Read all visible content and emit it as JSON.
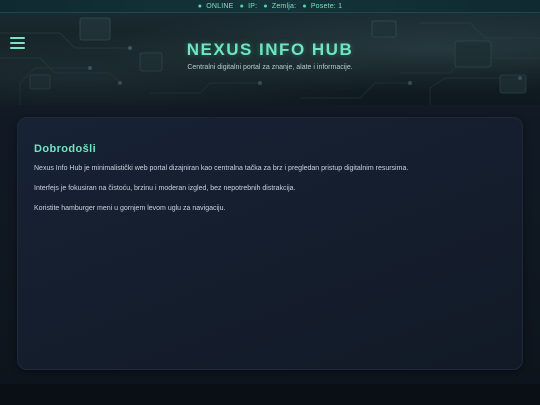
{
  "status": {
    "online": "ONLINE",
    "ip_label": "IP:",
    "country_label": "Zemlja:",
    "visits_label": "Posete: 1"
  },
  "header": {
    "title": "NEXUS INFO HUB",
    "subtitle": "Centralni digitalni portal za znanje, alate i informacije."
  },
  "menu": {
    "icon": "hamburger-menu-icon"
  },
  "card": {
    "title": "Dobrodošli",
    "paragraphs": [
      "Nexus Info Hub je minimalistički web portal dizajniran kao centralna tačka za brz i pregledan pristup digitalnim resursima.",
      "Interfejs je fokusiran na čistoću, brzinu i moderan izgled, bez nepotrebnih distrakcija.",
      "Koristite hamburger meni u gornjem levom uglu za navigaciju."
    ]
  },
  "colors": {
    "accent": "#6fe6c0",
    "background": "#0b1119",
    "card": "#162032"
  }
}
